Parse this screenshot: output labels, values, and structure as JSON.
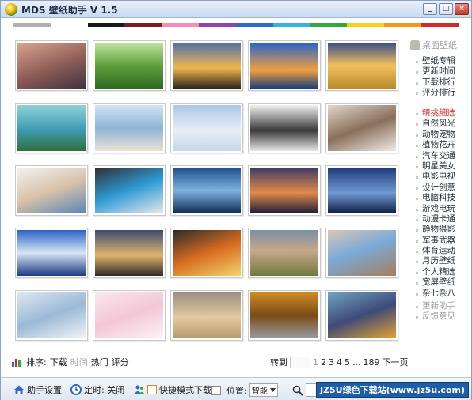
{
  "window": {
    "title": "MDS 壁纸助手 V 1.5",
    "controls": [
      "_",
      "□",
      "×"
    ]
  },
  "colorbar": [
    "#b0b0b0",
    "#ffffff",
    "#1a1a1a",
    "#7b1d1d",
    "#f28fb6",
    "#8e44ad",
    "#2d6bc9",
    "#33b3e8",
    "#2eaa3e",
    "#f2d11b",
    "#f29a1b",
    "#d42a2a"
  ],
  "thumbnails": [
    {
      "theme": "rocky-coast-sunset",
      "grad": "linear-gradient(160deg,#d8a58e,#8c5b56 55%,#3f3340)"
    },
    {
      "theme": "spring-meadow",
      "grad": "linear-gradient(180deg,#bfe39c,#5f9f3d 50%,#2f6a22)"
    },
    {
      "theme": "tipi-sunset",
      "grad": "linear-gradient(180deg,#4f6fa8,#f2b74d 55%,#2b2618)"
    },
    {
      "theme": "pier-blue-sunset",
      "grad": "linear-gradient(180deg,#2a63c9,#f0a040 60%,#1b3d7a)"
    },
    {
      "theme": "golden-field-sunset",
      "grad": "linear-gradient(180deg,#3b4e8a,#f3c15b 50%,#b98b2c)"
    },
    {
      "theme": "mossy-river",
      "grad": "linear-gradient(180deg,#8fd1d8,#3d9ab1 55%,#2e6f3f)"
    },
    {
      "theme": "girl-on-beach",
      "grad": "linear-gradient(180deg,#cfe3f3,#8fb3d6 50%,#e9e3d3)"
    },
    {
      "theme": "polar-bears",
      "grad": "linear-gradient(180deg,#aac8e8,#e8eef5 55%,#c6d6e6)"
    },
    {
      "theme": "group-models",
      "grad": "linear-gradient(180deg,#f0f0f0,#3a3a3a 55%,#e6e6e6)"
    },
    {
      "theme": "girl-lying",
      "grad": "linear-gradient(160deg,#e0d7cd,#8a6f5b 50%,#f0ebe6)"
    },
    {
      "theme": "girl-white-room",
      "grad": "linear-gradient(160deg,#f2f2f2,#d9c2a8 50%,#5b86b7)"
    },
    {
      "theme": "girl-blue-bed",
      "grad": "linear-gradient(160deg,#2f2f2f,#2f9bd6 50%,#e9e9e9)"
    },
    {
      "theme": "lake-clouds",
      "grad": "linear-gradient(180deg,#1f4f8f,#7fb2de 50%,#0e2c57)"
    },
    {
      "theme": "dusk-jetty",
      "grad": "linear-gradient(180deg,#3f3a63,#e08a4a 55%,#1d1d3a)"
    },
    {
      "theme": "mountain-sea-dusk",
      "grad": "linear-gradient(180deg,#1e3b78,#6f9ad3 55%,#0f1f46)"
    },
    {
      "theme": "mountain-reflection",
      "grad": "linear-gradient(180deg,#2c62c4,#d9e6f4 50%,#1c3a85)"
    },
    {
      "theme": "windmill-sunset",
      "grad": "linear-gradient(180deg,#3a4c72,#e1b36a 55%,#2d2b2b)"
    },
    {
      "theme": "iron-man",
      "grad": "linear-gradient(160deg,#2a2a2a,#d66b1f 50%,#f3d36b)"
    },
    {
      "theme": "girl-eyes-scarf",
      "grad": "linear-gradient(180deg,#7a8fa4,#c8a88a 45%,#6f7a3d)"
    },
    {
      "theme": "balloon-woods",
      "grad": "linear-gradient(160deg,#d9c8b9,#7aaad8 45%,#a67e5e)"
    },
    {
      "theme": "hand-branch",
      "grad": "linear-gradient(160deg,#dce7f2,#9bb9d6 50%,#f0f4f8)"
    },
    {
      "theme": "pink-blank",
      "grad": "linear-gradient(160deg,#fbe6ee,#f4c6d6 50%,#fdf1f5)"
    },
    {
      "theme": "sand-dunes",
      "grad": "linear-gradient(180deg,#9c8f84,#e4c9a0 55%,#b89a6e)"
    },
    {
      "theme": "autumn-path",
      "grad": "linear-gradient(180deg,#d08a25,#7a4c16 50%,#9a9aa0)"
    },
    {
      "theme": "pansies-bokeh",
      "grad": "linear-gradient(160deg,#6fa3bf,#3e4a78 50%,#e5a330)"
    }
  ],
  "sidebar": {
    "header": "桌面壁纸",
    "sort_items": [
      "壁纸专辑",
      "更新时间",
      "下载排行",
      "评分排行"
    ],
    "categories": [
      "精挑细选",
      "自然风光",
      "动物宠物",
      "植物花卉",
      "汽车交通",
      "明星美女",
      "电影电视",
      "设计创意",
      "电脑科技",
      "游戏电玩",
      "动漫卡通",
      "静物摄影",
      "军事武器",
      "体育运动",
      "月历壁纸",
      "个人精选",
      "宽屏壁纸",
      "杂七杂八"
    ],
    "footer_items": [
      "更新助手",
      "反馈意见"
    ]
  },
  "sortbar": {
    "label": "排序:",
    "options": [
      "下载",
      "时间",
      "热门",
      "评分"
    ]
  },
  "pager": {
    "goto": "转到",
    "current": "1",
    "pages": [
      "2",
      "3",
      "4",
      "5"
    ],
    "ellipsis": "...",
    "last": "189",
    "next": "下一页"
  },
  "statusbar": {
    "settings": "助手设置",
    "timer": "定时: 关闭",
    "fast_mode": "快捷模式下载",
    "position_label": "位置:",
    "position_value": "智能",
    "watermark": "JZ5U绿色下载站(www.jz5u.com)"
  },
  "colors": {
    "accent_red": "#d42a2a",
    "muted": "#9a9a9a",
    "window_border": "#8aa3c4"
  }
}
